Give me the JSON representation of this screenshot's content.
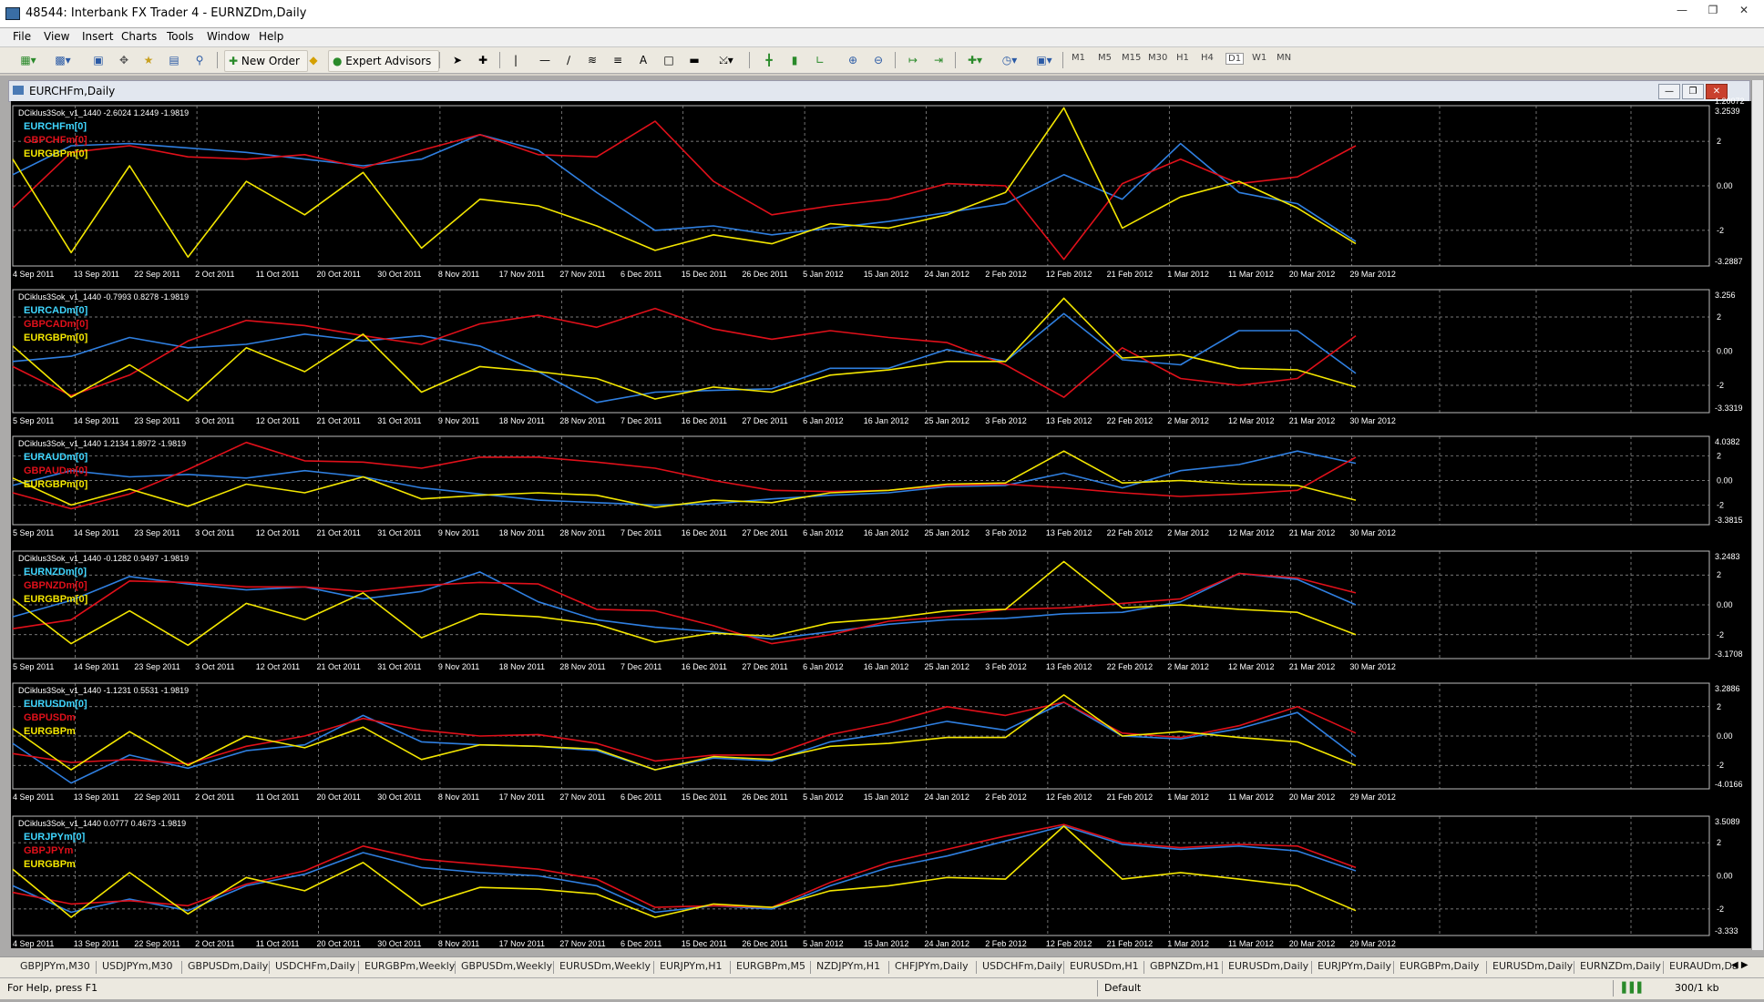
{
  "window": {
    "title": "48544: Interbank FX Trader 4 - EURNZDm,Daily"
  },
  "menu": [
    "File",
    "View",
    "Insert",
    "Charts",
    "Tools",
    "Window",
    "Help"
  ],
  "toolbar": {
    "new_order": "New Order",
    "expert_advisors": "Expert Advisors",
    "timeframes": [
      "M1",
      "M5",
      "M15",
      "M30",
      "H1",
      "H4",
      "D1",
      "W1",
      "MN"
    ]
  },
  "chart_window": {
    "title": "EURCHFm,Daily",
    "top_price": "1.20072"
  },
  "colors": {
    "series1": "#2f7fe0",
    "series2": "#e0101a",
    "series3": "#f3e600",
    "grid": "#a0a0a0",
    "axis_text": "#ffffff"
  },
  "chart_data": [
    {
      "type": "line",
      "indicator": "DCiklus3Sok_v1_1440 -2.6024 1.2449 -1.9819",
      "series_names": [
        "EURCHFm[0]",
        "GBPCHFm[0]",
        "EURGBPm[0]"
      ],
      "scale_max": "3.2539",
      "scale_min": "-3.2887",
      "ticks": [
        "2",
        "0.00",
        "-2"
      ],
      "dates": [
        "4 Sep 2011",
        "13 Sep 2011",
        "22 Sep 2011",
        "2 Oct 2011",
        "11 Oct 2011",
        "20 Oct 2011",
        "30 Oct 2011",
        "8 Nov 2011",
        "17 Nov 2011",
        "27 Nov 2011",
        "6 Dec 2011",
        "15 Dec 2011",
        "26 Dec 2011",
        "5 Jan 2012",
        "15 Jan 2012",
        "24 Jan 2012",
        "2 Feb 2012",
        "12 Feb 2012",
        "21 Feb 2012",
        "1 Mar 2012",
        "11 Mar 2012",
        "20 Mar 2012",
        "29 Mar 2012"
      ],
      "series": [
        {
          "name": "EURCHFm[0]",
          "values": [
            0.5,
            1.8,
            1.9,
            1.7,
            1.5,
            1.2,
            0.9,
            1.2,
            2.3,
            1.6,
            -0.3,
            -2.0,
            -1.8,
            -2.2,
            -1.9,
            -1.6,
            -1.2,
            -0.8,
            0.5,
            -0.6,
            1.9,
            -0.3,
            -0.8,
            -2.5
          ]
        },
        {
          "name": "GBPCHFm[0]",
          "values": [
            -1.0,
            1.5,
            1.8,
            1.3,
            1.2,
            1.4,
            0.8,
            1.6,
            2.3,
            1.4,
            1.3,
            2.9,
            0.2,
            -1.3,
            -0.9,
            -0.6,
            0.1,
            0.0,
            -3.3,
            0.1,
            1.2,
            0.1,
            0.4,
            1.8
          ]
        },
        {
          "name": "EURGBPm[0]",
          "values": [
            1.2,
            -3.0,
            0.9,
            -3.2,
            0.2,
            -1.3,
            0.6,
            -2.8,
            -0.6,
            -0.9,
            -1.8,
            -2.9,
            -2.2,
            -2.6,
            -1.7,
            -1.9,
            -1.3,
            -0.3,
            3.5,
            -1.9,
            -0.5,
            0.2,
            -1.0,
            -2.6
          ]
        }
      ]
    },
    {
      "type": "line",
      "indicator": "DCiklus3Sok_v1_1440 -0.7993 0.8278 -1.9819",
      "series_names": [
        "EURCADm[0]",
        "GBPCADm[0]",
        "EURGBPm[0]"
      ],
      "scale_max": "3.256",
      "scale_min": "-3.3319",
      "ticks": [
        "2",
        "0.00",
        "-2"
      ],
      "dates": [
        "5 Sep 2011",
        "14 Sep 2011",
        "23 Sep 2011",
        "3 Oct 2011",
        "12 Oct 2011",
        "21 Oct 2011",
        "31 Oct 2011",
        "9 Nov 2011",
        "18 Nov 2011",
        "28 Nov 2011",
        "7 Dec 2011",
        "16 Dec 2011",
        "27 Dec 2011",
        "6 Jan 2012",
        "16 Jan 2012",
        "25 Jan 2012",
        "3 Feb 2012",
        "13 Feb 2012",
        "22 Feb 2012",
        "2 Mar 2012",
        "12 Mar 2012",
        "21 Mar 2012",
        "30 Mar 2012"
      ],
      "series": [
        {
          "name": "EURCADm[0]",
          "values": [
            -0.6,
            -0.3,
            0.8,
            0.2,
            0.4,
            1.0,
            0.6,
            0.9,
            0.3,
            -1.2,
            -3.0,
            -2.4,
            -2.3,
            -2.2,
            -1.0,
            -1.0,
            0.1,
            -0.6,
            2.2,
            -0.5,
            -0.8,
            1.2,
            1.2,
            -1.3
          ]
        },
        {
          "name": "GBPCADm[0]",
          "values": [
            -0.9,
            -2.6,
            -1.4,
            0.6,
            1.8,
            1.5,
            0.9,
            0.4,
            1.6,
            2.1,
            1.4,
            2.5,
            1.3,
            0.7,
            1.2,
            0.8,
            0.5,
            -0.8,
            -2.7,
            0.2,
            -1.6,
            -2.0,
            -1.6,
            0.9
          ]
        },
        {
          "name": "EURGBPm[0]",
          "values": [
            0.3,
            -2.7,
            -0.8,
            -2.9,
            0.2,
            -1.2,
            1.0,
            -2.4,
            -0.9,
            -1.2,
            -1.6,
            -2.8,
            -2.1,
            -2.4,
            -1.4,
            -1.1,
            -0.6,
            -0.6,
            3.1,
            -0.4,
            -0.2,
            -1.0,
            -1.1,
            -2.1
          ]
        }
      ]
    },
    {
      "type": "line",
      "indicator": "DCiklus3Sok_v1_1440 1.2134 1.8972 -1.9819",
      "series_names": [
        "EURAUDm[0]",
        "GBPAUDm[0]",
        "EURGBPm[0]"
      ],
      "scale_max": "4.0382",
      "scale_min": "-3.3815",
      "ticks": [
        "2",
        "0.00",
        "-2"
      ],
      "dates": [
        "5 Sep 2011",
        "14 Sep 2011",
        "23 Sep 2011",
        "3 Oct 2011",
        "12 Oct 2011",
        "21 Oct 2011",
        "31 Oct 2011",
        "9 Nov 2011",
        "18 Nov 2011",
        "28 Nov 2011",
        "7 Dec 2011",
        "16 Dec 2011",
        "27 Dec 2011",
        "6 Jan 2012",
        "16 Jan 2012",
        "25 Jan 2012",
        "3 Feb 2012",
        "13 Feb 2012",
        "22 Feb 2012",
        "2 Mar 2012",
        "12 Mar 2012",
        "21 Mar 2012",
        "30 Mar 2012"
      ],
      "series": [
        {
          "name": "EURAUDm[0]",
          "values": [
            -0.4,
            0.8,
            0.3,
            0.5,
            0.2,
            0.8,
            0.3,
            -0.6,
            -1.1,
            -1.6,
            -1.8,
            -2.0,
            -1.9,
            -1.5,
            -1.2,
            -1.0,
            -0.5,
            -0.4,
            0.6,
            -0.6,
            0.8,
            1.3,
            2.4,
            1.4
          ]
        },
        {
          "name": "GBPAUDm[0]",
          "values": [
            -1.0,
            -2.3,
            -1.1,
            0.9,
            3.1,
            1.6,
            1.5,
            1.0,
            1.9,
            1.9,
            1.5,
            1.0,
            0.0,
            -0.8,
            -0.9,
            -0.8,
            -0.4,
            -0.3,
            -0.6,
            -1.0,
            -1.3,
            -1.1,
            -0.8,
            1.9
          ]
        },
        {
          "name": "EURGBPm[0]",
          "values": [
            0.2,
            -2.0,
            -0.7,
            -2.1,
            -0.3,
            -1.0,
            0.3,
            -1.5,
            -1.2,
            -1.0,
            -1.2,
            -2.2,
            -1.6,
            -1.8,
            -1.0,
            -0.8,
            -0.3,
            -0.2,
            2.4,
            -0.2,
            0.0,
            -0.3,
            -0.4,
            -1.6
          ]
        }
      ]
    },
    {
      "type": "line",
      "indicator": "DCiklus3Sok_v1_1440 -0.1282 0.9497 -1.9819",
      "series_names": [
        "EURNZDm[0]",
        "GBPNZDm[0]",
        "EURGBPm[0]"
      ],
      "scale_max": "3.2483",
      "scale_min": "-3.1708",
      "ticks": [
        "2",
        "0.00",
        "-2"
      ],
      "dates": [
        "5 Sep 2011",
        "14 Sep 2011",
        "23 Sep 2011",
        "3 Oct 2011",
        "12 Oct 2011",
        "21 Oct 2011",
        "31 Oct 2011",
        "9 Nov 2011",
        "18 Nov 2011",
        "28 Nov 2011",
        "7 Dec 2011",
        "16 Dec 2011",
        "27 Dec 2011",
        "6 Jan 2012",
        "16 Jan 2012",
        "25 Jan 2012",
        "3 Feb 2012",
        "13 Feb 2012",
        "22 Feb 2012",
        "2 Mar 2012",
        "12 Mar 2012",
        "21 Mar 2012",
        "30 Mar 2012"
      ],
      "series": [
        {
          "name": "EURNZDm[0]",
          "values": [
            -0.8,
            0.3,
            1.9,
            1.4,
            1.0,
            1.2,
            0.4,
            0.9,
            2.2,
            0.2,
            -1.0,
            -1.5,
            -1.8,
            -2.3,
            -1.8,
            -1.3,
            -1.0,
            -0.9,
            -0.6,
            -0.5,
            0.2,
            2.1,
            1.7,
            0.0
          ]
        },
        {
          "name": "GBPNZDm[0]",
          "values": [
            -1.6,
            -1.0,
            1.6,
            1.5,
            1.2,
            1.2,
            0.9,
            1.3,
            1.5,
            1.4,
            -0.3,
            -0.4,
            -1.4,
            -2.6,
            -2.0,
            -1.1,
            -0.8,
            -0.3,
            -0.2,
            0.1,
            0.4,
            2.1,
            1.8,
            0.8
          ]
        },
        {
          "name": "EURGBPm[0]",
          "values": [
            0.4,
            -2.6,
            -0.4,
            -2.7,
            0.1,
            -1.0,
            0.8,
            -2.2,
            -0.6,
            -0.8,
            -1.3,
            -2.5,
            -1.9,
            -2.1,
            -1.2,
            -0.9,
            -0.4,
            -0.3,
            2.9,
            -0.2,
            0.0,
            -0.3,
            -0.5,
            -2.0
          ]
        }
      ]
    },
    {
      "type": "line",
      "indicator": "DCiklus3Sok_v1_1440 -1.1231 0.5531 -1.9819",
      "series_names": [
        "EURUSDm[0]",
        "GBPUSDm",
        "EURGBPm"
      ],
      "scale_max": "3.2886",
      "scale_min": "-4.0166",
      "ticks": [
        "2",
        "0.00",
        "-2"
      ],
      "dates": [
        "4 Sep 2011",
        "13 Sep 2011",
        "22 Sep 2011",
        "2 Oct 2011",
        "11 Oct 2011",
        "20 Oct 2011",
        "30 Oct 2011",
        "8 Nov 2011",
        "17 Nov 2011",
        "27 Nov 2011",
        "6 Dec 2011",
        "15 Dec 2011",
        "26 Dec 2011",
        "5 Jan 2012",
        "15 Jan 2012",
        "24 Jan 2012",
        "2 Feb 2012",
        "12 Feb 2012",
        "21 Feb 2012",
        "1 Mar 2012",
        "11 Mar 2012",
        "20 Mar 2012",
        "29 Mar 2012"
      ],
      "series": [
        {
          "name": "EURUSDm[0]",
          "values": [
            -0.5,
            -3.2,
            -1.3,
            -2.2,
            -1.0,
            -0.6,
            1.4,
            -0.4,
            -0.6,
            -0.7,
            -1.0,
            -2.3,
            -1.5,
            -1.7,
            -0.4,
            0.2,
            1.0,
            0.4,
            2.3,
            0.0,
            -0.2,
            0.5,
            1.6,
            -1.4
          ]
        },
        {
          "name": "GBPUSDm",
          "values": [
            -1.2,
            -1.8,
            -1.6,
            -1.9,
            -0.7,
            0.0,
            1.2,
            0.4,
            0.0,
            0.1,
            -0.5,
            -1.7,
            -1.3,
            -1.3,
            0.1,
            0.9,
            2.0,
            1.4,
            2.3,
            0.2,
            -0.1,
            0.7,
            2.0,
            0.2
          ]
        },
        {
          "name": "EURGBPm",
          "values": [
            0.5,
            -2.3,
            0.3,
            -2.0,
            0.0,
            -0.8,
            0.6,
            -1.6,
            -0.6,
            -0.7,
            -0.9,
            -2.3,
            -1.4,
            -1.6,
            -0.7,
            -0.5,
            -0.1,
            -0.1,
            2.8,
            0.0,
            0.3,
            -0.1,
            -0.4,
            -2.0
          ]
        }
      ]
    },
    {
      "type": "line",
      "indicator": "DCiklus3Sok_v1_1440 0.0777 0.4673 -1.9819",
      "series_names": [
        "EURJPYm[0]",
        "GBPJPYm",
        "EURGBPm"
      ],
      "scale_max": "3.5089",
      "scale_min": "-3.333",
      "ticks": [
        "2",
        "0.00",
        "-2"
      ],
      "dates": [
        "4 Sep 2011",
        "13 Sep 2011",
        "22 Sep 2011",
        "2 Oct 2011",
        "11 Oct 2011",
        "20 Oct 2011",
        "30 Oct 2011",
        "8 Nov 2011",
        "17 Nov 2011",
        "27 Nov 2011",
        "6 Dec 2011",
        "15 Dec 2011",
        "26 Dec 2011",
        "5 Jan 2012",
        "15 Jan 2012",
        "24 Jan 2012",
        "2 Feb 2012",
        "12 Feb 2012",
        "21 Feb 2012",
        "1 Mar 2012",
        "11 Mar 2012",
        "20 Mar 2012",
        "29 Mar 2012"
      ],
      "series": [
        {
          "name": "EURJPYm[0]",
          "values": [
            -0.6,
            -2.2,
            -1.4,
            -2.1,
            -0.6,
            0.1,
            1.4,
            0.5,
            0.2,
            0.0,
            -0.6,
            -2.2,
            -1.8,
            -2.0,
            -0.6,
            0.5,
            1.2,
            2.1,
            3.0,
            1.9,
            1.6,
            1.8,
            1.5,
            0.3
          ]
        },
        {
          "name": "GBPJPYm",
          "values": [
            -1.0,
            -1.7,
            -1.5,
            -1.8,
            -0.5,
            0.3,
            1.8,
            1.0,
            0.7,
            0.4,
            -0.2,
            -1.9,
            -1.8,
            -1.9,
            -0.4,
            0.8,
            1.6,
            2.4,
            3.1,
            2.0,
            1.7,
            1.9,
            1.8,
            0.5
          ]
        },
        {
          "name": "EURGBPm",
          "values": [
            0.4,
            -2.5,
            0.2,
            -2.3,
            -0.1,
            -0.9,
            0.8,
            -1.8,
            -0.7,
            -0.8,
            -1.1,
            -2.5,
            -1.7,
            -1.9,
            -0.9,
            -0.6,
            -0.1,
            -0.2,
            3.0,
            -0.2,
            0.2,
            -0.2,
            -0.6,
            -2.1
          ]
        }
      ]
    }
  ],
  "tabs": [
    "GBPJPYm,M30",
    "USDJPYm,M30",
    "GBPUSDm,Daily",
    "USDCHFm,Daily",
    "EURGBPm,Weekly",
    "GBPUSDm,Weekly",
    "EURUSDm,Weekly",
    "EURJPYm,H1",
    "EURGBPm,M5",
    "NZDJPYm,H1",
    "CHFJPYm,Daily",
    "USDCHFm,Daily",
    "EURUSDm,H1",
    "GBPNZDm,H1",
    "EURUSDm,Daily",
    "EURJPYm,Daily",
    "EURGBPm,Daily",
    "EURUSDm,Daily",
    "EURNZDm,Daily",
    "EURAUDm,Da"
  ],
  "status": {
    "help": "For Help, press F1",
    "profile": "Default",
    "traffic": "300/1 kb"
  }
}
